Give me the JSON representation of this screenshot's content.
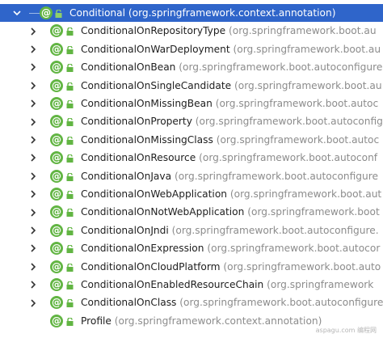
{
  "colors": {
    "selection": "#2f65ca",
    "annotation_icon": "#62b543",
    "package_text": "#8c8c8c"
  },
  "root": {
    "name": "Conditional",
    "package": "(org.springframework.context.annotation)",
    "icon": "annotation-icon",
    "expanded": true
  },
  "items": [
    {
      "name": "ConditionalOnRepositoryType",
      "package": "(org.springframework.boot.au",
      "expandable": true
    },
    {
      "name": "ConditionalOnWarDeployment",
      "package": "(org.springframework.boot.au",
      "expandable": true
    },
    {
      "name": "ConditionalOnBean",
      "package": "(org.springframework.boot.autoconfigure",
      "expandable": true
    },
    {
      "name": "ConditionalOnSingleCandidate",
      "package": "(org.springframework.boot.au",
      "expandable": true
    },
    {
      "name": "ConditionalOnMissingBean",
      "package": "(org.springframework.boot.autoc",
      "expandable": true
    },
    {
      "name": "ConditionalOnProperty",
      "package": "(org.springframework.boot.autoconfig",
      "expandable": true
    },
    {
      "name": "ConditionalOnMissingClass",
      "package": "(org.springframework.boot.autoc",
      "expandable": true
    },
    {
      "name": "ConditionalOnResource",
      "package": "(org.springframework.boot.autoconf",
      "expandable": true
    },
    {
      "name": "ConditionalOnJava",
      "package": "(org.springframework.boot.autoconfigure",
      "expandable": true
    },
    {
      "name": "ConditionalOnWebApplication",
      "package": "(org.springframework.boot.aut",
      "expandable": true
    },
    {
      "name": "ConditionalOnNotWebApplication",
      "package": "(org.springframework.boot",
      "expandable": true
    },
    {
      "name": "ConditionalOnJndi",
      "package": "(org.springframework.boot.autoconfigure.",
      "expandable": true
    },
    {
      "name": "ConditionalOnExpression",
      "package": "(org.springframework.boot.autocor",
      "expandable": true
    },
    {
      "name": "ConditionalOnCloudPlatform",
      "package": "(org.springframework.boot.auto",
      "expandable": true
    },
    {
      "name": "ConditionalOnEnabledResourceChain",
      "package": "(org.springframework",
      "expandable": true
    },
    {
      "name": "ConditionalOnClass",
      "package": "(org.springframework.boot.autoconfigure",
      "expandable": true
    },
    {
      "name": "Profile",
      "package": "(org.springframework.context.annotation)",
      "expandable": false
    }
  ],
  "watermark": "aspagu.com 编程网"
}
